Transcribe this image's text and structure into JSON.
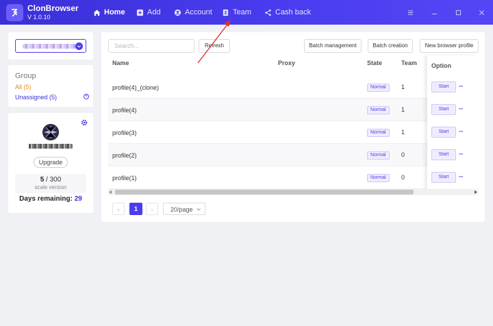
{
  "app": {
    "name": "ClonBrowser",
    "version": "V 1.0.10"
  },
  "nav": [
    {
      "label": "Home",
      "icon": "home-icon"
    },
    {
      "label": "Add",
      "icon": "plus-square-icon"
    },
    {
      "label": "Account",
      "icon": "account-circle-icon"
    },
    {
      "label": "Team",
      "icon": "team-doc-icon"
    },
    {
      "label": "Cash back",
      "icon": "share-icon"
    }
  ],
  "sidebar": {
    "group_title": "Group",
    "groups": [
      {
        "label": "All",
        "count": "(5)"
      },
      {
        "label": "Unassigned",
        "count": "(5)"
      }
    ],
    "profile": {
      "upgrade_label": "Upgrade",
      "usage_used": "5",
      "usage_total": "/ 300",
      "usage_caption": "scale version",
      "days_label": "Days remaining:",
      "days_value": "29"
    }
  },
  "toolbar": {
    "search_placeholder": "Search...",
    "refresh_label": "Refresh",
    "batch_management_label": "Batch management",
    "batch_creation_label": "Batch creation",
    "new_profile_label": "New browser profile"
  },
  "table": {
    "columns": {
      "name": "Name",
      "proxy": "Proxy",
      "state": "State",
      "team": "Team",
      "option": "Option"
    },
    "rows": [
      {
        "name": "profile(4)_(clone)",
        "proxy": "",
        "state": "Normal",
        "team": "1",
        "action": "Start"
      },
      {
        "name": "profile(4)",
        "proxy": "",
        "state": "Normal",
        "team": "1",
        "action": "Start"
      },
      {
        "name": "profile(3)",
        "proxy": "",
        "state": "Normal",
        "team": "1",
        "action": "Start"
      },
      {
        "name": "profile(2)",
        "proxy": "",
        "state": "Normal",
        "team": "0",
        "action": "Start"
      },
      {
        "name": "profile(1)",
        "proxy": "",
        "state": "Normal",
        "team": "0",
        "action": "Start"
      }
    ],
    "more_glyph": "···"
  },
  "pagination": {
    "current_page": "1",
    "page_size": "20/page",
    "prev_glyph": "‹",
    "next_glyph": "›"
  },
  "colors": {
    "accent": "#4a3df0",
    "topbar": "#3a2fd8",
    "arrow": "#e0302a",
    "all_group": "#e08a1f"
  }
}
